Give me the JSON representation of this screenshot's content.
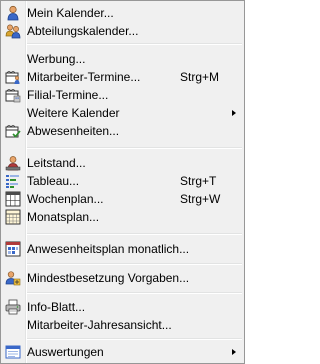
{
  "menu": {
    "items": [
      {
        "label": "Mein Kalender...",
        "shortcut": "",
        "submenu": false,
        "icon": "person-icon"
      },
      {
        "label": "Abteilungskalender...",
        "shortcut": "",
        "submenu": false,
        "icon": "group-icon"
      },
      {
        "label": "Werbung...",
        "shortcut": "",
        "submenu": false,
        "icon": ""
      },
      {
        "label": "Mitarbeiter-Termine...",
        "shortcut": "Strg+M",
        "submenu": false,
        "icon": "calendar-person-icon"
      },
      {
        "label": "Filial-Termine...",
        "shortcut": "",
        "submenu": false,
        "icon": "calendar-building-icon"
      },
      {
        "label": "Weitere Kalender",
        "shortcut": "",
        "submenu": true,
        "icon": ""
      },
      {
        "label": "Abwesenheiten...",
        "shortcut": "",
        "submenu": false,
        "icon": "calendar-check-icon"
      },
      {
        "label": "Leitstand...",
        "shortcut": "",
        "submenu": false,
        "icon": "operator-icon"
      },
      {
        "label": "Tableau...",
        "shortcut": "Strg+T",
        "submenu": false,
        "icon": "tableau-icon"
      },
      {
        "label": "Wochenplan...",
        "shortcut": "Strg+W",
        "submenu": false,
        "icon": "week-plan-icon"
      },
      {
        "label": "Monatsplan...",
        "shortcut": "",
        "submenu": false,
        "icon": "month-plan-icon"
      },
      {
        "label": "Anwesenheitsplan monatlich...",
        "shortcut": "",
        "submenu": false,
        "icon": "attendance-plan-icon"
      },
      {
        "label": "Mindestbesetzung Vorgaben...",
        "shortcut": "",
        "submenu": false,
        "icon": "staffing-icon"
      },
      {
        "label": "Info-Blatt...",
        "shortcut": "",
        "submenu": false,
        "icon": "printer-icon"
      },
      {
        "label": "Mitarbeiter-Jahresansicht...",
        "shortcut": "",
        "submenu": false,
        "icon": ""
      },
      {
        "label": "Auswertungen",
        "shortcut": "",
        "submenu": true,
        "icon": "reports-icon"
      }
    ]
  }
}
